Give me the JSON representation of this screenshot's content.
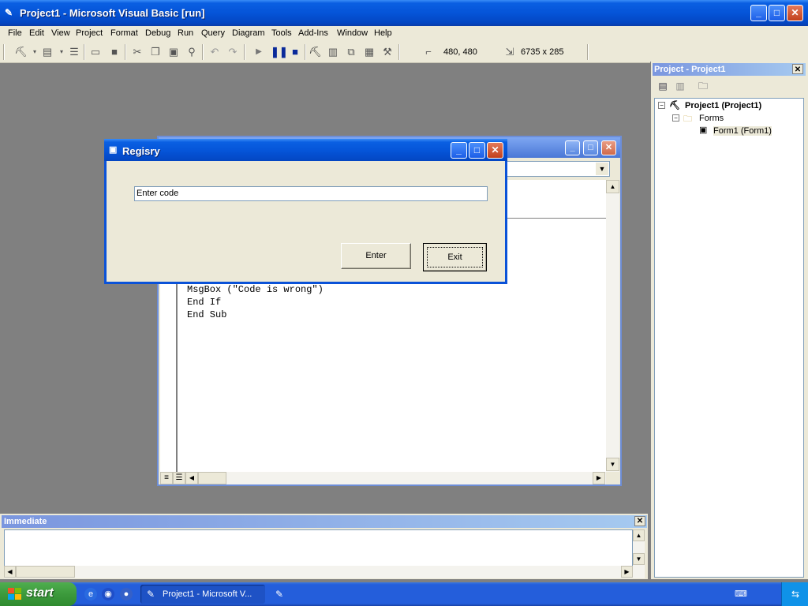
{
  "window": {
    "title": "Project1 - Microsoft Visual Basic [run]",
    "min": "_",
    "max": "□",
    "close": "✕"
  },
  "menu": [
    "File",
    "Edit",
    "View",
    "Project",
    "Format",
    "Debug",
    "Run",
    "Query",
    "Diagram",
    "Tools",
    "Add-Ins",
    "Window",
    "Help"
  ],
  "toolbar": {
    "position": "480, 480",
    "size": "6735 x 285"
  },
  "code_window": {
    "lines": [
      "MsgBox (\"Code is wrong\")",
      "End If",
      "End Sub"
    ]
  },
  "dialog": {
    "title": "Regisry",
    "input_value": "Enter code",
    "enter_label": "Enter",
    "exit_label": "Exit"
  },
  "project_panel": {
    "title": "Project - Project1",
    "root": "Project1 (Project1)",
    "folder": "Forms",
    "item": "Form1 (Form1)"
  },
  "immediate": {
    "title": "Immediate"
  },
  "taskbar": {
    "start_label": "start",
    "task_label": "Project1 - Microsoft V..."
  }
}
